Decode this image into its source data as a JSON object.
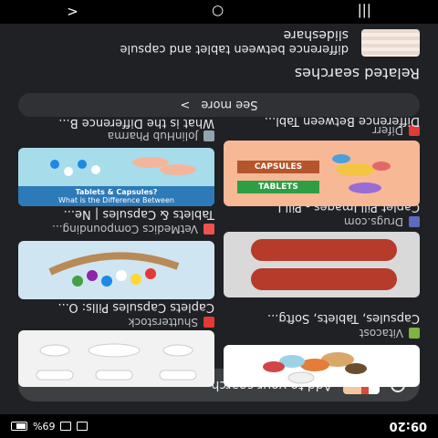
{
  "status": {
    "time": "09:20",
    "battery": "69%"
  },
  "search_bar": {
    "label": "Add to your search"
  },
  "results": [
    {
      "source": "Vitacost",
      "title": "Capsules, Tablets, Softg..."
    },
    {
      "source": "Shutterstock",
      "title": "Caplets Capsules Pills: O..."
    },
    {
      "source": "Drugs.com",
      "title": "Caplet Pill Images - Pill I..."
    },
    {
      "source": "VetMedics Compounding...",
      "title": "Tablets & Capsules | Ne..."
    },
    {
      "source": "Diferr",
      "title": "Difference Between Tabl..."
    },
    {
      "source": "JolinHub Pharma",
      "title": "What is the Difference B..."
    }
  ],
  "image_text": {
    "capsules": "CAPSULES",
    "tablets": "TABLETS",
    "infographic_line1": "Tablets & Capsules?",
    "infographic_line2": "What is the Difference Between"
  },
  "see_more": {
    "label": "See more",
    "arrow": ">"
  },
  "related": {
    "heading": "Related searches"
  },
  "suggestion": {
    "title": "slideshare",
    "subtitle": "difference between tablet and capsule"
  },
  "nav": {
    "recent": "|||",
    "home": "○",
    "back": "<"
  }
}
